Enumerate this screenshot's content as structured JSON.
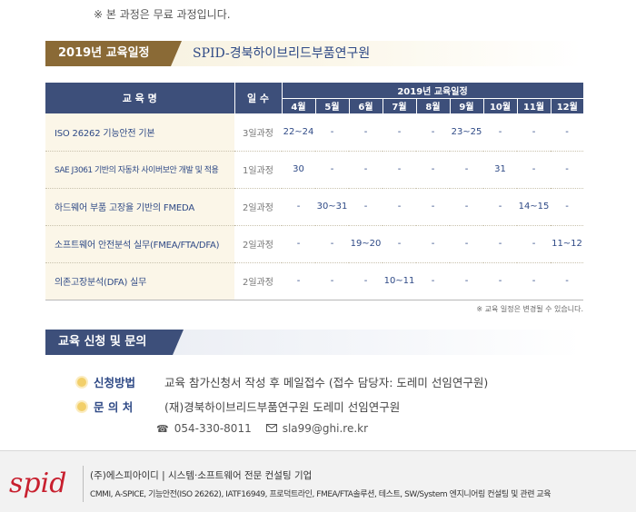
{
  "notice": "※ 본 과정은 무료 과정입니다.",
  "schedule_section": {
    "tag": "2019년 교육일정",
    "title": "SPID-경북하이브리드부품연구원"
  },
  "table": {
    "col_course": "교 육 명",
    "col_days": "일 수",
    "col_schedule": "2019년 교육일정",
    "months": [
      "4월",
      "5월",
      "6월",
      "7월",
      "8월",
      "9월",
      "10월",
      "11월",
      "12월"
    ],
    "rows": [
      {
        "course": "ISO 26262 기능안전 기본",
        "days": "3일과정",
        "months": [
          "22~24",
          "-",
          "-",
          "-",
          "-",
          "23~25",
          "-",
          "-",
          "-"
        ]
      },
      {
        "course": "SAE J3061 기반의 자동차 사이버보안 개발 및 적용",
        "days": "1일과정",
        "months": [
          "30",
          "-",
          "-",
          "-",
          "-",
          "-",
          "31",
          "-",
          "-"
        ]
      },
      {
        "course": "하드웨어 부품 고장율 기반의 FMEDA",
        "days": "2일과정",
        "months": [
          "-",
          "30~31",
          "-",
          "-",
          "-",
          "-",
          "-",
          "14~15",
          "-"
        ]
      },
      {
        "course": "소프트웨어 안전분석 실무(FMEA/FTA/DFA)",
        "days": "2일과정",
        "months": [
          "-",
          "-",
          "19~20",
          "-",
          "-",
          "-",
          "-",
          "-",
          "11~12"
        ]
      },
      {
        "course": "의존고장분석(DFA) 실무",
        "days": "2일과정",
        "months": [
          "-",
          "-",
          "-",
          "10~11",
          "-",
          "-",
          "-",
          "-",
          "-"
        ]
      }
    ],
    "note": "※ 교육 일정은 변경될 수 있습니다."
  },
  "inquiry_section": {
    "tag": "교육 신청 및 문의",
    "method_label": "신청방법",
    "method_text": "교육 참가신청서 작성 후 메일접수 (접수 담당자: 도레미 선임연구원)",
    "contact_label": "문 의 처",
    "contact_text": "(재)경북하이브리드부품연구원 도레미 선임연구원",
    "phone": "054-330-8011",
    "email": "sla99@ghi.re.kr"
  },
  "footer": {
    "logo_text": "spid",
    "line1": "(주)에스피아이디 | 시스템·소프트웨어 전문 컨설팅 기업",
    "line2": "CMMI, A-SPICE, 기능안전(ISO 26262), IATF16949, 프로덕트라인, FMEA/FTA솔루션, 테스트, SW/System 엔지니어링 컨설팅 및 관련 교육",
    "brand_color": "#c8202f"
  },
  "icons": {
    "phone": "phone-icon",
    "email": "envelope-icon"
  }
}
